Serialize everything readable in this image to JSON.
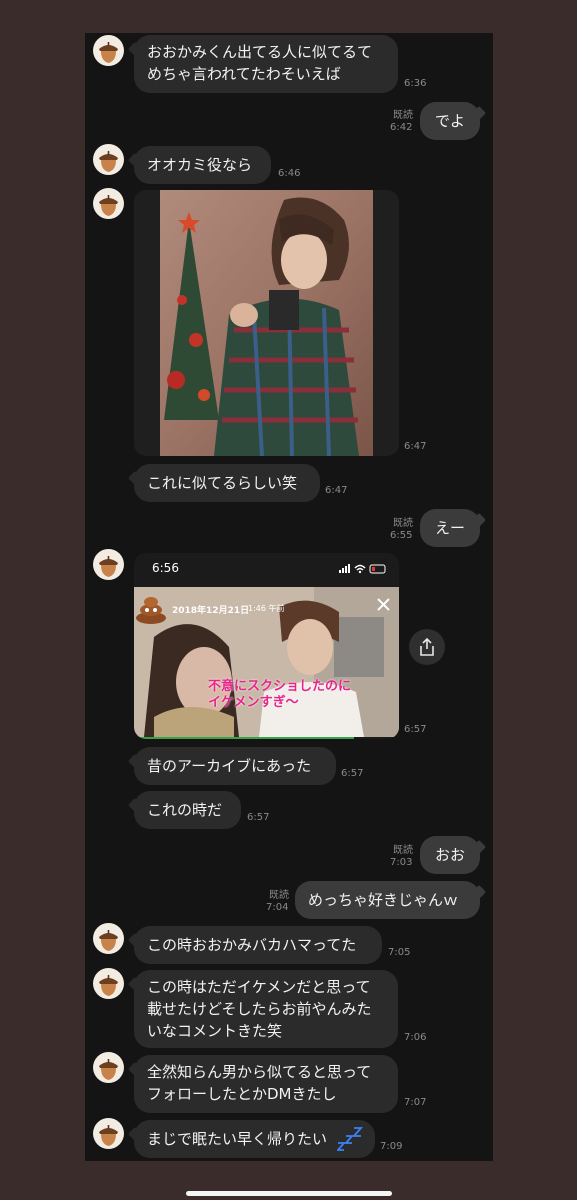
{
  "messages": {
    "m1": {
      "text": "おおかみくん出てる人に似てるて\nめちゃ言われてたわそいえば",
      "time": "6:36"
    },
    "m2": {
      "text": "でよ",
      "read": "既読",
      "time": "6:42"
    },
    "m3": {
      "text": "オオカミ役なら",
      "time": "6:46"
    },
    "m4": {
      "time": "6:47"
    },
    "m5": {
      "text": "これに似てるらしい笑",
      "time": "6:47"
    },
    "m6": {
      "text": "えー",
      "read": "既読",
      "time": "6:55"
    },
    "m7": {
      "time": "6:57",
      "status_time": "6:56",
      "post_date": "2018年12月21日",
      "post_time": "1:46 午前",
      "caption_line1": "不意にスクショしたのに",
      "caption_line2": "イケメンすぎ〜"
    },
    "m8": {
      "text": "昔のアーカイブにあった",
      "time": "6:57"
    },
    "m9": {
      "text": "これの時だ",
      "time": "6:57"
    },
    "m10": {
      "text": "おお",
      "read": "既読",
      "time": "7:03"
    },
    "m11": {
      "text": "めっちゃ好きじゃんｗ",
      "read": "既読",
      "time": "7:04"
    },
    "m12": {
      "text": "この時おおかみバカハマってた",
      "time": "7:05"
    },
    "m13": {
      "text": "この時はただイケメンだと思って\n載せたけどそしたらお前やんみた\nいなコメントきた笑",
      "time": "7:06"
    },
    "m14": {
      "text": "全然知らん男から似てると思って\nフォローしたとかDMきたし",
      "time": "7:07"
    },
    "m15": {
      "text": "まじで眠たい早く帰りたい",
      "time": "7:09"
    }
  },
  "colors": {
    "panel_bg": "#141414",
    "incoming_bubble": "#2b2b2b",
    "outgoing_bubble": "#3b3b3b",
    "caption_pink": "#e8238a"
  },
  "icons": [
    "acorn-icon",
    "share-icon",
    "close-icon",
    "poop-emoji-icon",
    "sleep-zzz-icon"
  ]
}
